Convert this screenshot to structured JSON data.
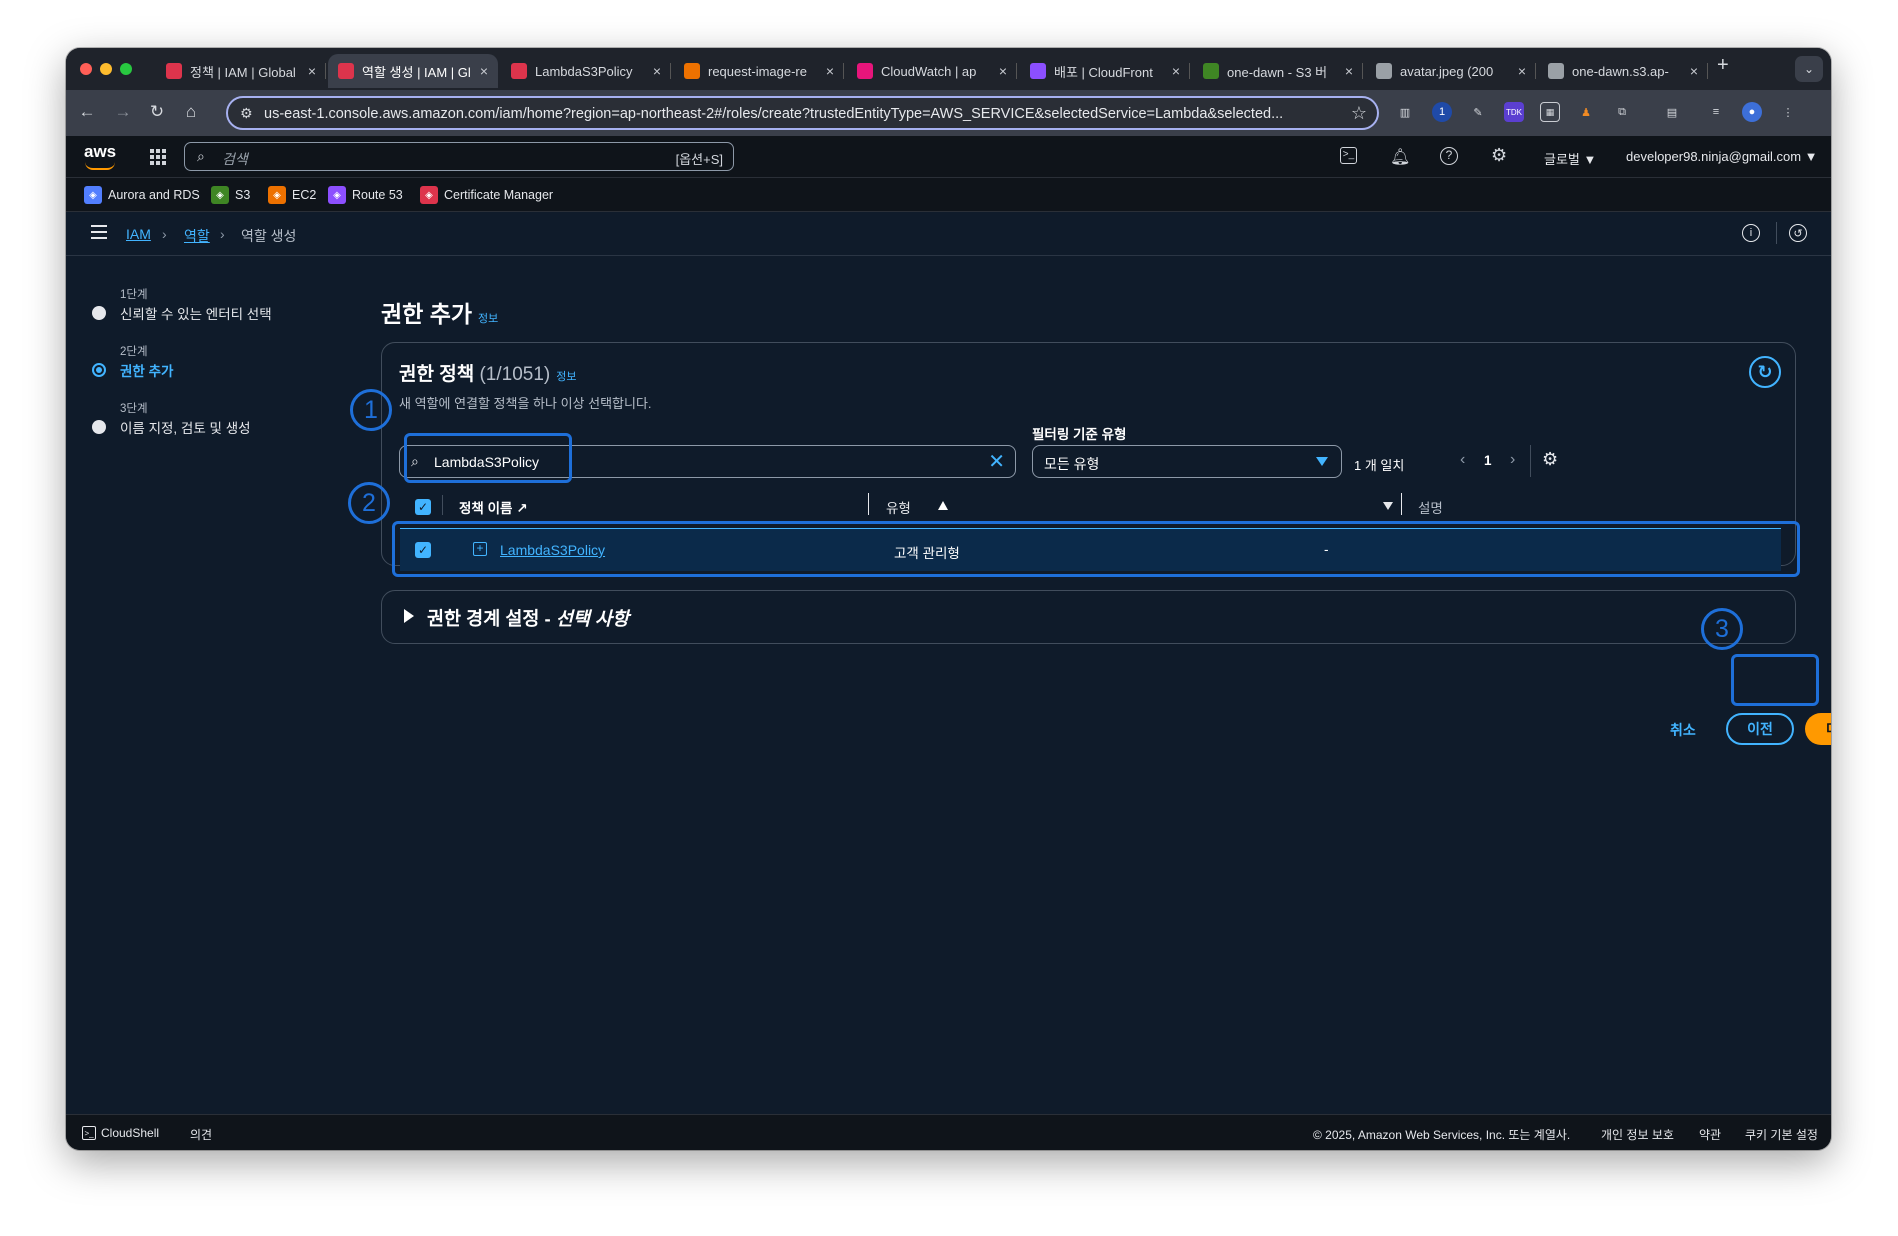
{
  "browser": {
    "tabs": [
      {
        "title": "정책 | IAM | Global",
        "color": "#dd344c"
      },
      {
        "title": "역할 생성 | IAM | Gl",
        "color": "#dd344c",
        "active": true
      },
      {
        "title": "LambdaS3Policy",
        "color": "#dd344c"
      },
      {
        "title": "request-image-re",
        "color": "#ed7100"
      },
      {
        "title": "CloudWatch | ap",
        "color": "#e7157b"
      },
      {
        "title": "배포 | CloudFront",
        "color": "#8c4fff"
      },
      {
        "title": "one-dawn - S3 버",
        "color": "#3f8624"
      },
      {
        "title": "avatar.jpeg (200",
        "color": "#9aa0a6"
      },
      {
        "title": "one-dawn.s3.ap-",
        "color": "#9aa0a6"
      }
    ],
    "new_tab": "+",
    "url": "us-east-1.console.aws.amazon.com/iam/home?region=ap-northeast-2#/roles/create?trustedEntityType=AWS_SERVICE&selectedService=Lambda&selected..."
  },
  "aws_header": {
    "logo": "aws",
    "search_placeholder": "검색",
    "search_shortcut": "[옵션+S]",
    "region": "글로벌 ▼",
    "account": "developer98.ninja@gmail.com ▼"
  },
  "favorites": [
    {
      "label": "Aurora and RDS",
      "color": "#527fff"
    },
    {
      "label": "S3",
      "color": "#3f8624"
    },
    {
      "label": "EC2",
      "color": "#ed7100"
    },
    {
      "label": "Route 53",
      "color": "#8c4fff"
    },
    {
      "label": "Certificate Manager",
      "color": "#dd344c"
    }
  ],
  "breadcrumb": {
    "items": [
      "IAM",
      "역할",
      "역할 생성"
    ],
    "separator": "›"
  },
  "steps": [
    {
      "number": "1단계",
      "label": "신뢰할 수 있는 엔터티 선택"
    },
    {
      "number": "2단계",
      "label": "권한 추가",
      "active": true
    },
    {
      "number": "3단계",
      "label": "이름 지정, 검토 및 생성"
    }
  ],
  "page": {
    "title": "권한 추가",
    "info": "정보"
  },
  "policies": {
    "title": "권한 정책",
    "count": "(1/1051)",
    "info": "정보",
    "description": "새 역할에 연결할 정책을 하나 이상 선택합니다.",
    "search_value": "LambdaS3Policy",
    "filter_label": "필터링 기준 유형",
    "filter_value": "모든 유형",
    "matches": "1 개 일치",
    "page": "1",
    "columns": {
      "name": "정책 이름",
      "type": "유형",
      "description": "설명"
    },
    "rows": [
      {
        "name": "LambdaS3Policy",
        "type": "고객 관리형",
        "description": "-",
        "checked": true
      }
    ]
  },
  "boundary": {
    "title": "권한 경계 설정 - ",
    "optional": "선택 사항"
  },
  "actions": {
    "cancel": "취소",
    "previous": "이전",
    "next": "다음"
  },
  "annotations": [
    "1",
    "2",
    "3"
  ],
  "footer": {
    "cloudshell": "CloudShell",
    "feedback": "의견",
    "copyright": "© 2025, Amazon Web Services, Inc. 또는 계열사.",
    "privacy": "개인 정보 보호",
    "terms": "약관",
    "cookies": "쿠키 기본 설정"
  },
  "colors": {
    "accent": "#42b4ff",
    "primary_button": "#ff9900",
    "annotation": "#1e6fd9",
    "background": "#0f1b2a"
  }
}
